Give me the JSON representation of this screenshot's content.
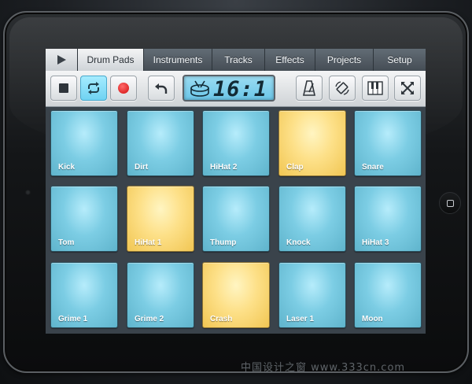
{
  "tabs": [
    {
      "label": "",
      "icon": "play-icon",
      "kind": "play"
    },
    {
      "label": "Drum Pads",
      "active": true
    },
    {
      "label": "Instruments"
    },
    {
      "label": "Tracks"
    },
    {
      "label": "Effects"
    },
    {
      "label": "Projects"
    },
    {
      "label": "Setup"
    }
  ],
  "toolbar": {
    "buttons": [
      {
        "icon": "stop-icon"
      },
      {
        "icon": "loop-icon",
        "active": true
      },
      {
        "icon": "record-icon"
      },
      {
        "icon": "undo-icon"
      },
      {
        "icon": "metronome-icon"
      },
      {
        "icon": "rotate-icon"
      },
      {
        "icon": "piano-icon"
      },
      {
        "icon": "fullscreen-icon"
      }
    ],
    "lcd": {
      "icon": "drum-icon",
      "value": "16:1"
    }
  },
  "pads": [
    {
      "label": "Kick",
      "active": false
    },
    {
      "label": "Dirt",
      "active": false
    },
    {
      "label": "HiHat 2",
      "active": false
    },
    {
      "label": "Clap",
      "active": true
    },
    {
      "label": "Snare",
      "active": false
    },
    {
      "label": "Tom",
      "active": false
    },
    {
      "label": "HiHat 1",
      "active": true
    },
    {
      "label": "Thump",
      "active": false
    },
    {
      "label": "Knock",
      "active": false
    },
    {
      "label": "HiHat 3",
      "active": false
    },
    {
      "label": "Grime 1",
      "active": false
    },
    {
      "label": "Grime 2",
      "active": false
    },
    {
      "label": "Crash",
      "active": true
    },
    {
      "label": "Laser 1",
      "active": false
    },
    {
      "label": "Moon",
      "active": false
    }
  ],
  "colors": {
    "pad_idle": "#7ccde4",
    "pad_active": "#fde088",
    "record": "#d10d0d",
    "loop_active": "#6fd2f2"
  },
  "watermark": "中国设计之窗 www.333cn.com"
}
